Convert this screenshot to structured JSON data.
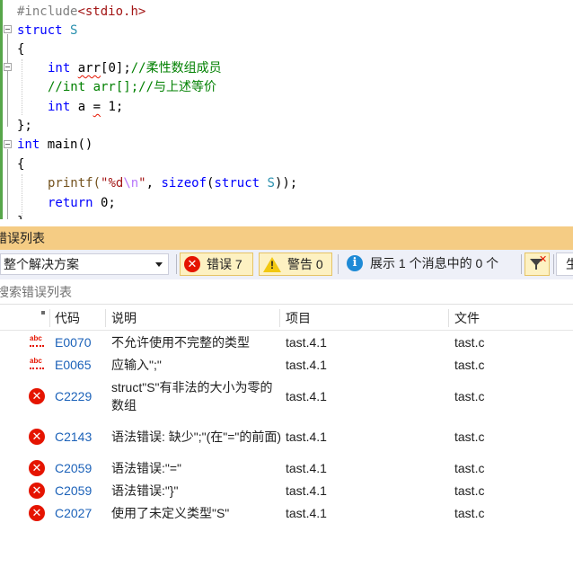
{
  "editor": {
    "lines": [
      "#include<stdio.h>",
      "struct S",
      "{",
      "int arr[0];//柔性数组成员",
      "//int arr[];//与上述等价",
      "int a = 1;",
      "};",
      "int main()",
      "{",
      "printf(\"%d\\n\", sizeof(struct S));",
      "return 0;"
    ],
    "tokens": {
      "include_kw": "#include",
      "include_hdr": "<stdio.h>",
      "struct_kw": "struct",
      "S": "S",
      "int_kw": "int",
      "arr": "arr",
      "arr_rest": "[0];",
      "comment1": "//柔性数组成员",
      "comment2": "//int arr[];//与上述等价",
      "a_pre": "a ",
      "eq": "=",
      "a_post": " 1;",
      "main": " main()",
      "printf": "printf(",
      "fmt_open": "\"%d",
      "fmt_esc": "\\n",
      "fmt_close": "\"",
      "comma": ", ",
      "sizeof": "sizeof",
      "paren_open": "(",
      "paren_close": "));",
      "return": "return",
      "ret_val": " 0;",
      "brace_open": "{",
      "brace_close": "};"
    }
  },
  "panel": {
    "title": "错误列表",
    "scope": "整个解决方案",
    "errors_button": "错误 7",
    "warnings_button": "警告 0",
    "messages_button": "展示 1 个消息中的 0 个",
    "build_button_cut": "生",
    "search_placeholder": "搜索错误列表",
    "headers": {
      "code": "代码",
      "description": "说明",
      "project": "项目",
      "file": "文件"
    }
  },
  "rows": [
    {
      "icon": "spelling-error-icon",
      "code": "E0070",
      "description": "不允许使用不完整的类型",
      "project": "tast.4.1",
      "file": "tast.c"
    },
    {
      "icon": "spelling-error-icon",
      "code": "E0065",
      "description": "应输入\";\"",
      "project": "tast.4.1",
      "file": "tast.c"
    },
    {
      "icon": "error-icon",
      "code": "C2229",
      "description": "struct\"S\"有非法的大小为零的数组",
      "project": "tast.4.1",
      "file": "tast.c"
    },
    {
      "icon": "error-icon",
      "code": "C2143",
      "description": "语法错误: 缺少\";\"(在\"=\"的前面)",
      "project": "tast.4.1",
      "file": "tast.c"
    },
    {
      "icon": "error-icon",
      "code": "C2059",
      "description": "语法错误:\"=\"",
      "project": "tast.4.1",
      "file": "tast.c"
    },
    {
      "icon": "error-icon",
      "code": "C2059",
      "description": "语法错误:\"}\"",
      "project": "tast.4.1",
      "file": "tast.c"
    },
    {
      "icon": "error-icon",
      "code": "C2027",
      "description": "使用了未定义类型\"S\"",
      "project": "tast.4.1",
      "file": "tast.c"
    }
  ],
  "colors": {
    "panel_title_bg": "#f5cc84",
    "toolbar_bg": "#eef0f8",
    "error_red": "#e51400",
    "code_link": "#1c62b9",
    "keyword": "#0000ff",
    "type": "#2b91af",
    "comment": "#008000",
    "string": "#a31515",
    "change_bar": "#57a64a"
  }
}
